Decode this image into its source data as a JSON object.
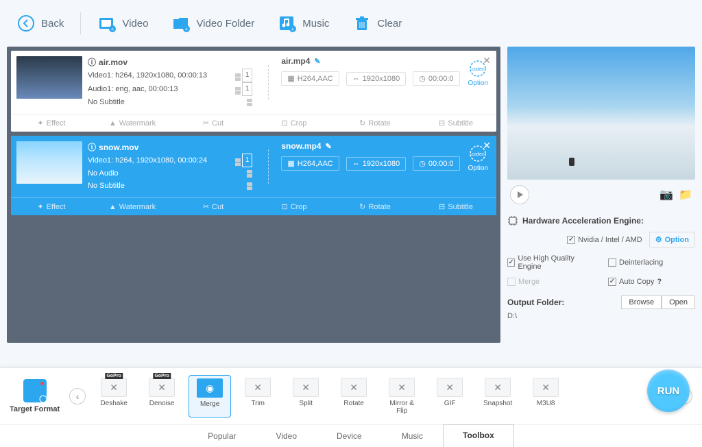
{
  "toolbar": {
    "back": "Back",
    "video": "Video",
    "video_folder": "Video Folder",
    "music": "Music",
    "clear": "Clear"
  },
  "files": [
    {
      "src_name": "air.mov",
      "video_track": "Video1: h264, 1920x1080, 00:00:13",
      "video_count": "1",
      "audio_track": "Audio1: eng, aac, 00:00:13",
      "audio_count": "1",
      "subtitle": "No Subtitle",
      "out_name": "air.mp4",
      "out_codec": "H264,AAC",
      "out_res": "1920x1080",
      "out_dur": "00:00:0",
      "option": "Option",
      "selected": false
    },
    {
      "src_name": "snow.mov",
      "video_track": "Video1: h264, 1920x1080, 00:00:24",
      "video_count": "1",
      "audio_track": "No Audio",
      "audio_count": "",
      "subtitle": "No Subtitle",
      "out_name": "snow.mp4",
      "out_codec": "H264,AAC",
      "out_res": "1920x1080",
      "out_dur": "00:00:0",
      "option": "Option",
      "selected": true
    }
  ],
  "card_tools": {
    "effect": "Effect",
    "watermark": "Watermark",
    "cut": "Cut",
    "crop": "Crop",
    "rotate": "Rotate",
    "subtitle": "Subtitle"
  },
  "right": {
    "hw_title": "Hardware Acceleration Engine:",
    "hw_vendor": "Nvidia / Intel / AMD",
    "option": "Option",
    "hq_engine": "Use High Quality Engine",
    "deinterlacing": "Deinterlacing",
    "merge": "Merge",
    "auto_copy": "Auto Copy",
    "help": "?",
    "output_folder_label": "Output Folder:",
    "output_folder_path": "D:\\",
    "browse": "Browse",
    "open": "Open"
  },
  "strip": {
    "target_format": "Target Format",
    "tools": [
      {
        "label": "Deshake",
        "gopro": true
      },
      {
        "label": "Denoise",
        "gopro": true
      },
      {
        "label": "Merge",
        "active": true,
        "blue": true
      },
      {
        "label": "Trim"
      },
      {
        "label": "Split"
      },
      {
        "label": "Rotate"
      },
      {
        "label": "Mirror & Flip"
      },
      {
        "label": "GIF"
      },
      {
        "label": "Snapshot"
      },
      {
        "label": "M3U8"
      }
    ],
    "run": "RUN"
  },
  "tabs": {
    "items": [
      "Popular",
      "Video",
      "Device",
      "Music",
      "Toolbox"
    ],
    "active": "Toolbox"
  }
}
